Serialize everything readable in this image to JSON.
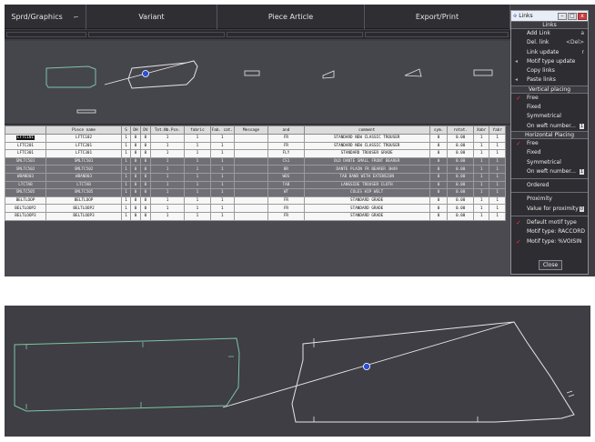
{
  "menubar": {
    "items": [
      "Sprd/Graphics",
      "Variant",
      "Piece Article",
      "Export/Print"
    ]
  },
  "grid": {
    "headers": [
      "",
      "Piece name",
      "S",
      "DH",
      "DV",
      "Tot.Nb.Pce.",
      "fabric",
      "Fab. cat.",
      "Message",
      "and",
      "comment",
      "sym.",
      "rotat.",
      "Xabr",
      "Yabr"
    ],
    "rows": [
      [
        "LFTC101",
        "LFTC102",
        "1",
        "0",
        "0",
        "1",
        "1",
        "1",
        "",
        "FR",
        "STANDARD NEW CLASSIC TROUSER",
        "0",
        "0.00",
        "1",
        "1"
      ],
      [
        "LFTC201",
        "LFTC201",
        "1",
        "0",
        "0",
        "1",
        "1",
        "1",
        "",
        "FR",
        "STANDARD NEW CLASSIC TROUSER",
        "0",
        "0.00",
        "1",
        "1"
      ],
      [
        "LFTC301",
        "LFTC301",
        "1",
        "0",
        "0",
        "1",
        "1",
        "1",
        "",
        "FLY",
        "STANDARD TROUSER GRADE",
        "0",
        "0.00",
        "1",
        "1"
      ],
      [
        "SMLTC501",
        "SMLTC501",
        "1",
        "0",
        "0",
        "1",
        "1",
        "1",
        "",
        "CS1",
        "OLD DANTE SMALL FRONT BEARER",
        "0",
        "0.00",
        "1",
        "1"
      ],
      [
        "SMLTC502",
        "SMLTC502",
        "1",
        "0",
        "0",
        "1",
        "1",
        "1",
        "",
        "BR",
        "DANTE PLAIN FR BEARER 3H49",
        "0",
        "0.00",
        "1",
        "1"
      ],
      [
        "WBAND03",
        "WBAND03",
        "1",
        "0",
        "0",
        "1",
        "1",
        "1",
        "",
        "WBS",
        "TAB BAND WITH EXTENSION",
        "0",
        "0.00",
        "1",
        "1"
      ],
      [
        "LTCTAB",
        "LTCTAB",
        "1",
        "0",
        "0",
        "1",
        "1",
        "1",
        "",
        "TAB",
        "LANGSIDE TROUSER CLOTH",
        "0",
        "0.00",
        "1",
        "1"
      ],
      [
        "SMLTC505",
        "SMLTC505",
        "1",
        "0",
        "0",
        "1",
        "1",
        "1",
        "",
        "WT",
        "COLES HIP WELT",
        "0",
        "0.00",
        "1",
        "1"
      ],
      [
        "BELTLOOP",
        "BELTLOOP",
        "1",
        "0",
        "0",
        "1",
        "1",
        "1",
        "",
        "FR",
        "STANDARD GRADE",
        "0",
        "0.00",
        "1",
        "1"
      ],
      [
        "BELTLOOP2",
        "BELTLOOP2",
        "1",
        "0",
        "0",
        "1",
        "1",
        "1",
        "",
        "FR",
        "STANDARD GRADE",
        "0",
        "0.00",
        "1",
        "1"
      ],
      [
        "BELTLOOP3",
        "BELTLOOP3",
        "1",
        "0",
        "0",
        "1",
        "1",
        "1",
        "",
        "FR",
        "STANDARD GRADE",
        "0",
        "0.00",
        "1",
        "1"
      ]
    ],
    "dark_rows": [
      3,
      4,
      5,
      6,
      7
    ]
  },
  "links_panel": {
    "title": "Links",
    "sections": {
      "links": "Links",
      "vertical": "Vertical placing",
      "horizontal": "Horizontal Placing"
    },
    "link_items": [
      {
        "label": "Add Link",
        "key": "a"
      },
      {
        "label": "Del. link",
        "key": "<Del>"
      },
      {
        "label": "Link update",
        "key": "r"
      },
      {
        "label": "Motif type update",
        "key": ""
      },
      {
        "label": "Copy links",
        "key": ""
      },
      {
        "label": "Paste links",
        "key": ""
      }
    ],
    "vertical_items": [
      {
        "label": "Free",
        "checked": true
      },
      {
        "label": "Fixed",
        "checked": false
      },
      {
        "label": "Symmetrical",
        "checked": false
      },
      {
        "label": "On weft number...",
        "checked": false,
        "value": "1"
      }
    ],
    "horizontal_items": [
      {
        "label": "Free",
        "checked": true
      },
      {
        "label": "Fixed",
        "checked": false
      },
      {
        "label": "Symmetrical",
        "checked": false
      },
      {
        "label": "On weft number...",
        "checked": false,
        "value": "1"
      }
    ],
    "ordered": "Ordered",
    "proximity": "Proximity",
    "proximity_value_label": "Value for proximity",
    "proximity_value": "0",
    "motif_items": [
      {
        "label": "Default motif type",
        "checked": true
      },
      {
        "label": "Motif type: RACCORD",
        "checked": false
      },
      {
        "label": "Motif type: %VOISIN",
        "checked": true
      }
    ],
    "close": "Close",
    "window_close_glyph": "x"
  },
  "colors": {
    "accent_red": "#e03c3c",
    "piece_green": "#7fc4a6",
    "anchor_blue": "#2c4fd8"
  }
}
